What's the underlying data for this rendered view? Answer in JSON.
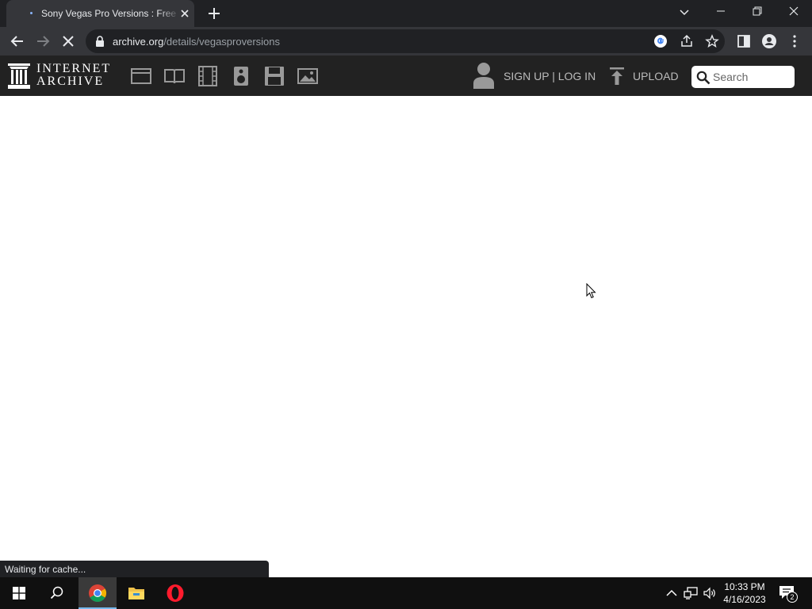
{
  "browser": {
    "tab_title": "Sony Vegas Pro Versions : Free Download, Borrow, and Streaming",
    "url_host": "archive.org",
    "url_path": "/details/vegasproversions",
    "status_text": "Waiting for cache..."
  },
  "ia_nav": {
    "wordmark_line1": "INTERNET",
    "wordmark_line2": "ARCHIVE",
    "media_icons": [
      "web-icon",
      "texts-icon",
      "video-icon",
      "audio-icon",
      "software-icon",
      "images-icon"
    ],
    "signup_login": "SIGN UP | LOG IN",
    "upload": "UPLOAD",
    "search_placeholder": "Search"
  },
  "taskbar": {
    "time": "10:33 PM",
    "date": "4/16/2023",
    "notification_count": "2"
  },
  "colors": {
    "chrome_dark": "#202124",
    "chrome_toolbar": "#35363a",
    "ia_nav_bg": "#222222",
    "taskbar_bg": "#101010",
    "accent_blue": "#76b9ed"
  }
}
